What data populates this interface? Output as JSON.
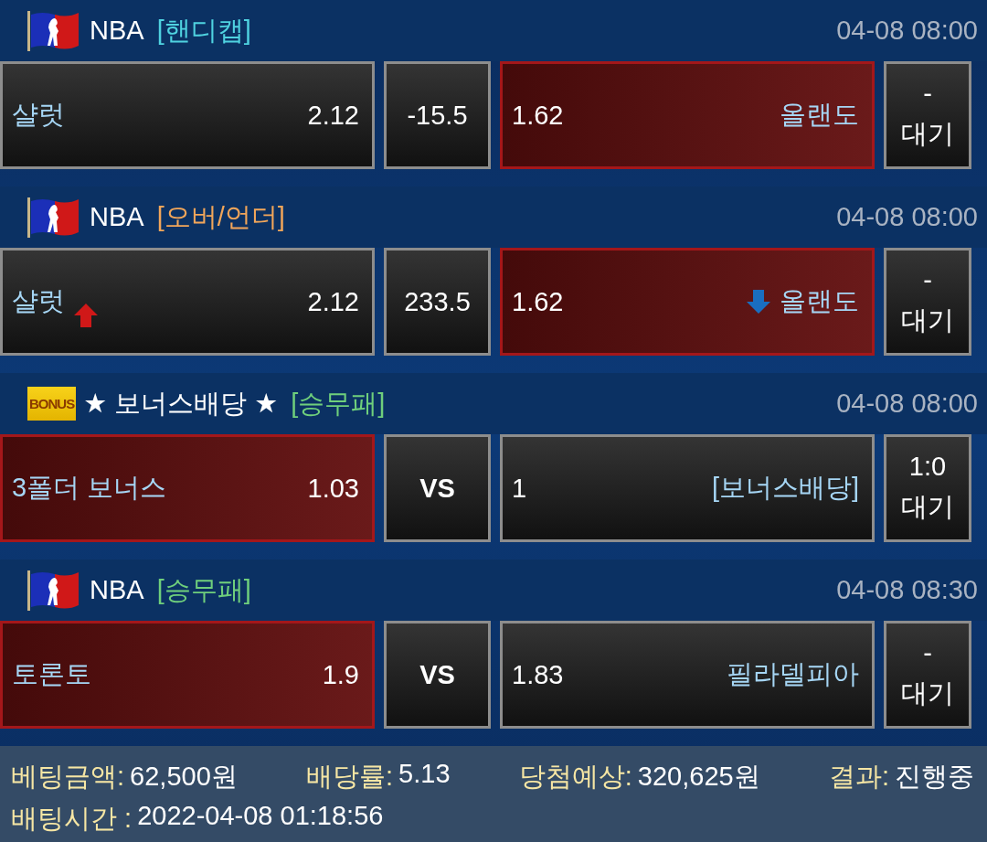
{
  "games": [
    {
      "header": {
        "kind": "league",
        "league": "NBA",
        "market": {
          "text": "[핸디캡]",
          "color": "#4fd2e0"
        },
        "time": "04-08 08:00"
      },
      "home": {
        "name": "샬럿",
        "odds": "2.12",
        "selected": false,
        "rising": false
      },
      "middle": {
        "kind": "line",
        "text": "-15.5"
      },
      "away": {
        "odds": "1.62",
        "name": "올랜도",
        "selected": true,
        "falling": false
      },
      "result": {
        "score": "-",
        "status": "대기"
      }
    },
    {
      "header": {
        "kind": "league",
        "league": "NBA",
        "market": {
          "text": "[오버/언더]",
          "color": "#f2a65a"
        },
        "time": "04-08 08:00"
      },
      "home": {
        "name": "샬럿",
        "odds": "2.12",
        "selected": false,
        "rising": true
      },
      "middle": {
        "kind": "line",
        "text": "233.5"
      },
      "away": {
        "odds": "1.62",
        "name": "올랜도",
        "selected": true,
        "falling": true
      },
      "result": {
        "score": "-",
        "status": "대기"
      }
    },
    {
      "header": {
        "kind": "bonus",
        "badge": "BONUS",
        "league": "★ 보너스배당 ★",
        "market": {
          "text": "[승무패]",
          "color": "#6fcf7c"
        },
        "time": "04-08 08:00"
      },
      "home": {
        "name": "3폴더 보너스",
        "odds": "1.03",
        "selected": true,
        "rising": false
      },
      "middle": {
        "kind": "vs",
        "text": "VS"
      },
      "away": {
        "odds": "1",
        "name": "[보너스배당]",
        "selected": false,
        "falling": false
      },
      "result": {
        "score": "1:0",
        "status": "대기"
      }
    },
    {
      "header": {
        "kind": "league",
        "league": "NBA",
        "market": {
          "text": "[승무패]",
          "color": "#6fcf7c"
        },
        "time": "04-08 08:30"
      },
      "home": {
        "name": "토론토",
        "odds": "1.9",
        "selected": true,
        "rising": false
      },
      "middle": {
        "kind": "vs",
        "text": "VS"
      },
      "away": {
        "odds": "1.83",
        "name": "필라델피아",
        "selected": false,
        "falling": false
      },
      "result": {
        "score": "-",
        "status": "대기"
      }
    }
  ],
  "summary": {
    "row_1": [
      {
        "label": "베팅금액:",
        "value": "62,500원"
      },
      {
        "label": "배당률:",
        "value": "5.13"
      },
      {
        "label": "당첨예상:",
        "value": "320,625원"
      },
      {
        "label": "결과:",
        "value": "진행중"
      }
    ],
    "row_2": [
      {
        "label": "배팅시간 :",
        "value": "2022-04-08 01:18:56"
      }
    ]
  }
}
